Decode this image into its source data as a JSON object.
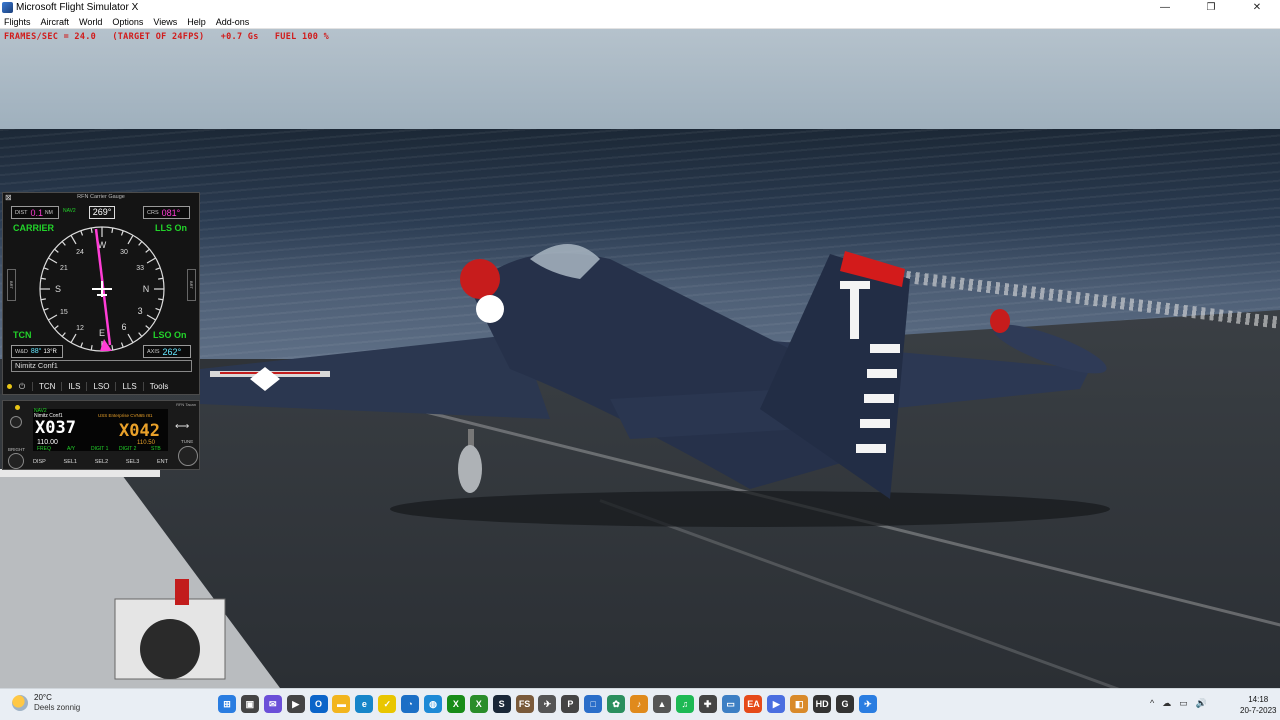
{
  "window": {
    "title": "Microsoft Flight Simulator X",
    "controls": {
      "minimize": "—",
      "maximize": "❐",
      "close": "✕"
    }
  },
  "menu": [
    "Flights",
    "Aircraft",
    "World",
    "Options",
    "Views",
    "Help",
    "Add-ons"
  ],
  "overlay": {
    "frame_rate": "FRAMES/SEC = 24.0   (TARGET OF 24FPS)   +0.7 Gs   FUEL 100 %"
  },
  "gauge": {
    "title": "RFN Carrier Gauge",
    "close": "⊠",
    "dist_label": "DIST",
    "dist_value": "0.1",
    "dist_unit": "NM",
    "nav": "NAV2",
    "heading": "269°",
    "crs_label": "CRS",
    "crs_value": "081°",
    "carrier": "CARRIER",
    "lls_top": "LLS On",
    "tcn": "TCN",
    "lso": "LSO On",
    "wind_label": "W&D",
    "wind_value": "88°",
    "wind_speed": "13°R",
    "axis_label": "AXIS",
    "axis_value": "262°",
    "compass": [
      "N",
      "3",
      "6",
      "E",
      "12",
      "15",
      "S",
      "21",
      "24",
      "W",
      "30",
      "33"
    ],
    "left_btn": "BRT",
    "right_btn": "BRT",
    "config": "Nimitz Conf1",
    "tabs": [
      "TCN",
      "ILS",
      "LSO",
      "LLS",
      "Tools"
    ],
    "power": "⏻",
    "colors": {
      "cyan": "#66e7ff",
      "magenta": "#ff3dd6",
      "green": "#22d32a"
    }
  },
  "tacan": {
    "title": "RFN Tacan",
    "conf": "Nimitz Conf1",
    "nav": "NAV2",
    "active_channel": "X037",
    "active_freq": "110.00",
    "standby_label": "USS Enterprise CVN65 r81",
    "standby_channel": "X042",
    "standby_freq": "110.50",
    "freq": "FREQ",
    "ay": "A/Y",
    "digit1": "DIGIT 1",
    "digit2": "DIGIT 2",
    "stb": "STB",
    "tune": "TUNE",
    "bright": "BRIGHT",
    "buttons": [
      "DISP",
      "SEL1",
      "SEL2",
      "SEL3",
      "ENT"
    ],
    "swap": "⟷"
  },
  "taskbar": {
    "temp": "20°C",
    "weather": "Deels zonnig",
    "icons": [
      {
        "name": "start-icon",
        "glyph": "⊞",
        "color": "#2a7de1"
      },
      {
        "name": "task-view-icon",
        "glyph": "▣",
        "color": "#444"
      },
      {
        "name": "chat-icon",
        "glyph": "✉",
        "color": "#6b4fd8"
      },
      {
        "name": "video-icon",
        "glyph": "▶",
        "color": "#444"
      },
      {
        "name": "outlook-icon",
        "glyph": "O",
        "color": "#0a64c9"
      },
      {
        "name": "file-explorer-icon",
        "glyph": "▬",
        "color": "#f2b51d"
      },
      {
        "name": "edge-icon",
        "glyph": "e",
        "color": "#1685c9"
      },
      {
        "name": "norton-icon",
        "glyph": "✓",
        "color": "#e9c600"
      },
      {
        "name": "clock-app-icon",
        "glyph": "◔",
        "color": "#1c6fc6"
      },
      {
        "name": "globe-icon",
        "glyph": "◍",
        "color": "#1e8ad6"
      },
      {
        "name": "xbox-icon",
        "glyph": "X",
        "color": "#188c18"
      },
      {
        "name": "xbox-app-icon",
        "glyph": "X",
        "color": "#2a8d2a"
      },
      {
        "name": "steam-icon",
        "glyph": "S",
        "color": "#1b2838"
      },
      {
        "name": "fsx-icon",
        "glyph": "FS",
        "color": "#7a5a3a"
      },
      {
        "name": "plane-app-icon",
        "glyph": "✈",
        "color": "#555"
      },
      {
        "name": "p3d-icon",
        "glyph": "P",
        "color": "#444"
      },
      {
        "name": "window-icon",
        "glyph": "□",
        "color": "#2a6ec9"
      },
      {
        "name": "fern-icon",
        "glyph": "✿",
        "color": "#2b8f5e"
      },
      {
        "name": "music-icon",
        "glyph": "♪",
        "color": "#e08a1c"
      },
      {
        "name": "terrain-icon",
        "glyph": "▲",
        "color": "#555"
      },
      {
        "name": "spotify-icon",
        "glyph": "♫",
        "color": "#1db954"
      },
      {
        "name": "drone-icon",
        "glyph": "✚",
        "color": "#444"
      },
      {
        "name": "monitor-icon",
        "glyph": "▭",
        "color": "#3d7fc4"
      },
      {
        "name": "ea-icon",
        "glyph": "EA",
        "color": "#e64a19"
      },
      {
        "name": "media-player-icon",
        "glyph": "▶",
        "color": "#4a6ee0"
      },
      {
        "name": "photos-icon",
        "glyph": "◧",
        "color": "#d98a2a"
      },
      {
        "name": "hd-icon",
        "glyph": "HD",
        "color": "#333"
      },
      {
        "name": "g-icon",
        "glyph": "G",
        "color": "#333"
      },
      {
        "name": "fsx-active-icon",
        "glyph": "✈",
        "color": "#2a7de1"
      }
    ],
    "tray": [
      "^",
      "☁",
      "▭",
      "🔊"
    ],
    "time": "14:18",
    "date": "20-7-2023"
  }
}
